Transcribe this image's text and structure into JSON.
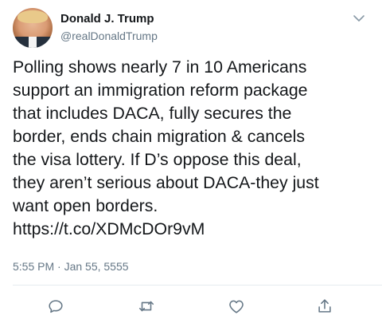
{
  "author": {
    "display_name": "Donald J. Trump",
    "handle": "@realDonaldTrump"
  },
  "tweet": {
    "lines": [
      "Polling shows nearly 7 in 10 Americans",
      "support an immigration reform package",
      "that includes DACA, fully secures the",
      "border, ends chain migration & cancels",
      "the visa lottery. If D’s oppose this deal,",
      "they aren’t serious about DACA-they just",
      "want open borders.",
      "https://t.co/XDMcDOr9vM"
    ],
    "timestamp": "5:55 PM · Jan 55, 5555"
  },
  "icons": {
    "menu": "chevron-down-icon",
    "reply": "reply-icon",
    "retweet": "retweet-icon",
    "like": "heart-icon",
    "share": "share-icon"
  },
  "colors": {
    "text": "#14171a",
    "secondary": "#657786",
    "icon": "#657786",
    "divider": "#e6ecf0"
  }
}
